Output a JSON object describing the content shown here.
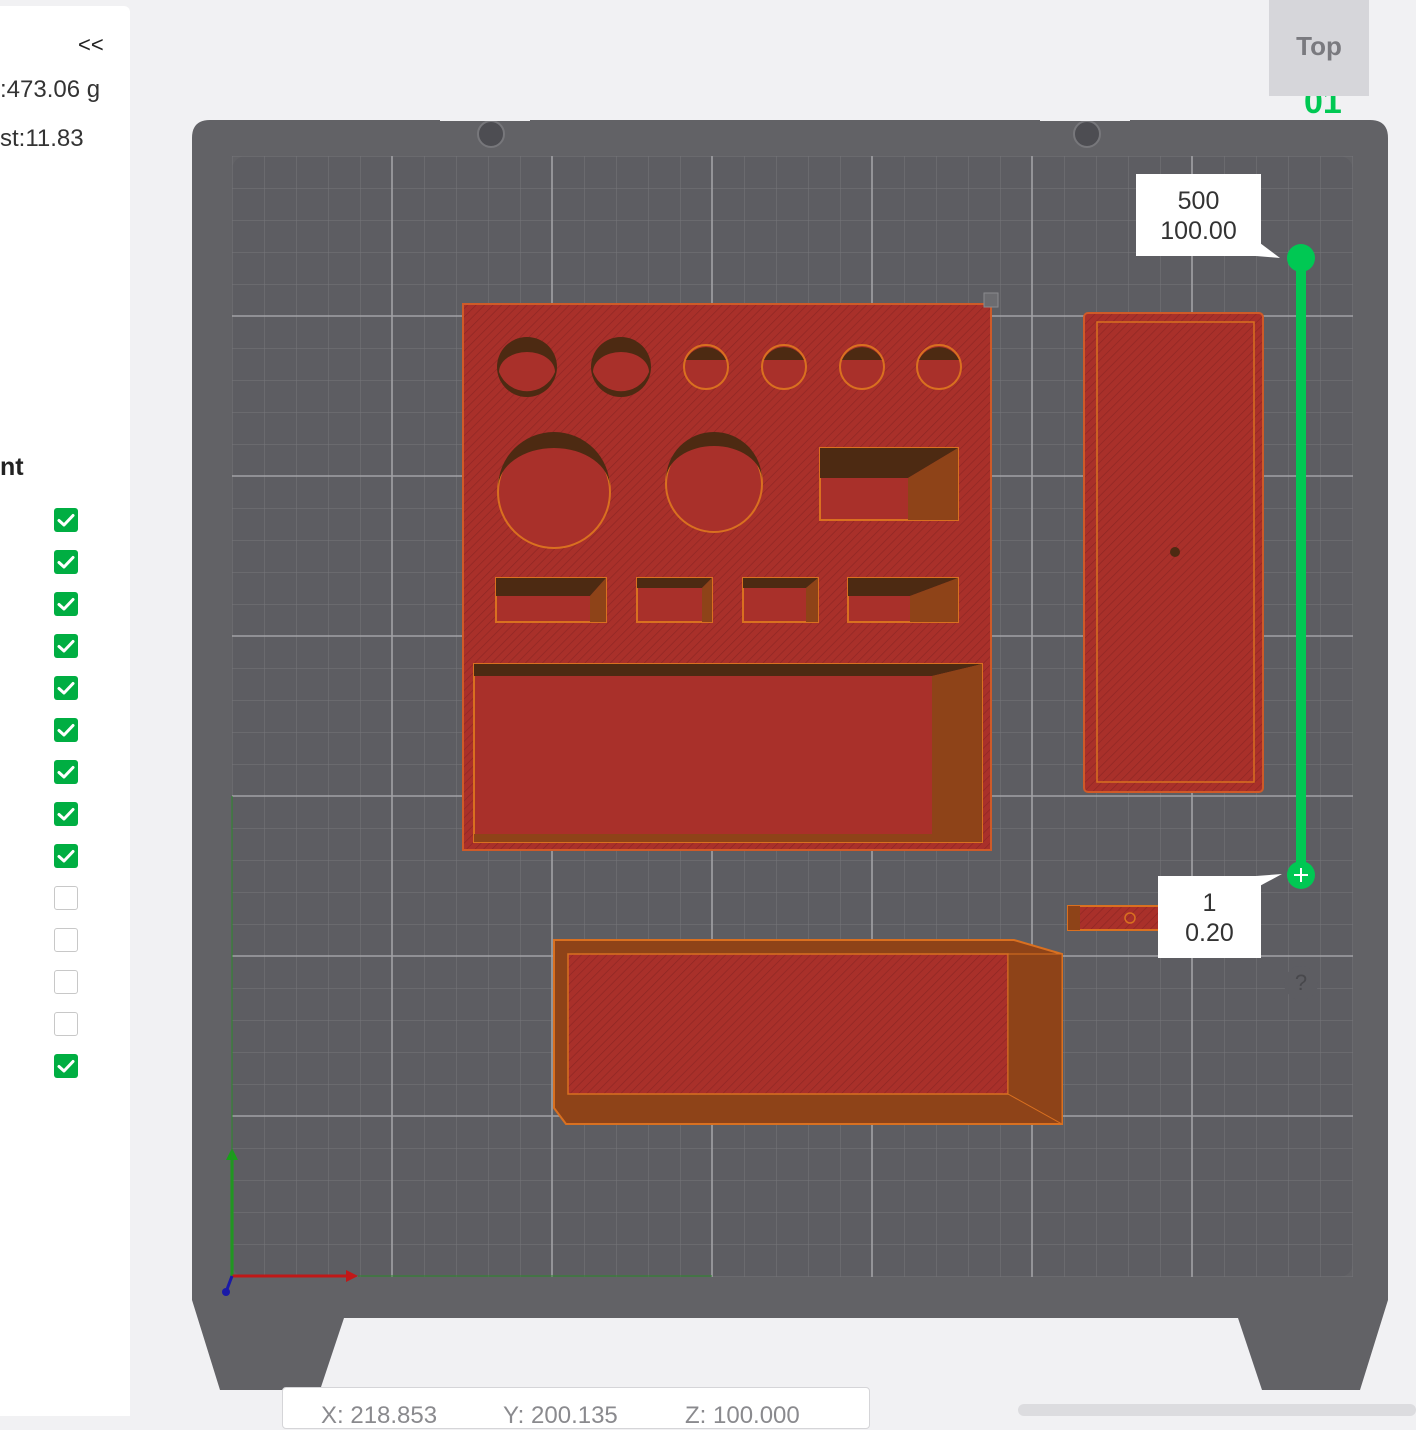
{
  "sidebar": {
    "collapse_label": "<<",
    "weight_text": ":473.06 g",
    "cost_text": "st:11.83",
    "section_title": "nt",
    "checkboxes": [
      true,
      true,
      true,
      true,
      true,
      true,
      true,
      true,
      true,
      false,
      false,
      false,
      false,
      true
    ]
  },
  "view": {
    "label": "Top",
    "layer_digit": "01"
  },
  "layer_slider": {
    "top_layer": "500",
    "top_height": "100.00",
    "bottom_layer": "1",
    "bottom_height": "0.20",
    "upper_fraction": 1.0,
    "lower_fraction": 0.0,
    "color": "#00c853"
  },
  "help": {
    "label": "?"
  },
  "coords": {
    "x": "X: 218.853",
    "y": "Y: 200.135",
    "z": "Z: 100.000"
  },
  "colors": {
    "plate": "#5d5d62",
    "plate_frame": "#626266",
    "model_top": "#a9302a",
    "model_wall": "#8e4318",
    "accent": "#00ae42"
  }
}
